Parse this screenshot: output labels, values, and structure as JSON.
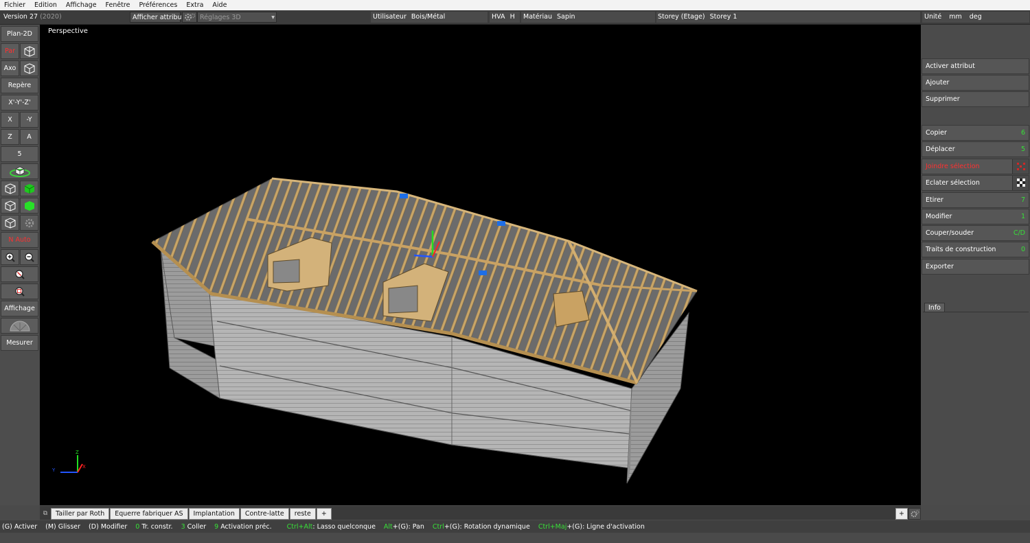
{
  "menu": [
    "Fichier",
    "Edition",
    "Affichage",
    "Fenêtre",
    "Préférences",
    "Extra",
    "Aide"
  ],
  "toolbar": {
    "version": "Version 27",
    "version_year": "(2020)",
    "show_attribute": "Afficher attribut",
    "settings_3d": "Réglages 3D",
    "user_label": "Utilisateur",
    "user_value": "Bois/Métal",
    "hva_label": "HVA",
    "hva_value": "H",
    "material_label": "Matériau",
    "material_value": "Sapin",
    "storey_label": "Storey (Etage)",
    "storey_value": "Storey 1",
    "unit_label": "Unité",
    "unit_length": "mm",
    "unit_angle": "deg"
  },
  "left_buttons": {
    "plan2d": "Plan-2D",
    "par": "Par",
    "axo": "Axo",
    "repere": "Repère",
    "xyz": "X'-Y'-Z'",
    "x": "X",
    "minus_y": "-Y",
    "z": "Z",
    "a": "A",
    "five": "5",
    "auto": "N Auto",
    "affichage": "Affichage",
    "mesurer": "Mesurer"
  },
  "viewport": {
    "label": "Perspective",
    "axis_z": "Z",
    "axis_y": "Y",
    "axis_x": "X"
  },
  "right_panel": {
    "activate_attr": "Activer attribut",
    "add": "Ajouter",
    "delete": "Supprimer",
    "items": [
      {
        "label": "Copier",
        "key": "6"
      },
      {
        "label": "Déplacer",
        "key": "5"
      },
      {
        "label": "Joindre sélection",
        "key": ""
      },
      {
        "label": "Eclater sélection",
        "key": ""
      },
      {
        "label": "Etirer",
        "key": "7"
      },
      {
        "label": "Modifier",
        "key": "1"
      },
      {
        "label": "Couper/souder",
        "key": "C/D"
      },
      {
        "label": "Traits de construction",
        "key": "0"
      },
      {
        "label": "Exporter",
        "key": ""
      }
    ],
    "info_tab": "Info"
  },
  "tabs": [
    "Tailler par Roth",
    "Equerre fabriquer AS",
    "Implantation",
    "Contre-latte",
    "reste",
    "+"
  ],
  "tabs_right": "+",
  "status": [
    {
      "key": "(G)",
      "text": "Activer",
      "key_green": false
    },
    {
      "key": "(M)",
      "text": "Glisser",
      "key_green": false
    },
    {
      "key": "(D)",
      "text": "Modifier",
      "key_green": false
    },
    {
      "key": "0",
      "text": "Tr. constr.",
      "key_green": true
    },
    {
      "key": "3",
      "text": "Coller",
      "key_green": true
    },
    {
      "key": "9",
      "text": "Activation préc.",
      "key_green": true
    },
    {
      "key": "Ctrl+Alt",
      "text": ": Lasso quelconque",
      "key_green": true
    },
    {
      "key": "Alt",
      "text": "+(G): Pan",
      "key_green": true
    },
    {
      "key": "Ctrl",
      "text": "+(G): Rotation dynamique",
      "key_green": true
    },
    {
      "key": "Ctrl+Maj",
      "text": "+(G): Ligne d'activation",
      "key_green": true
    }
  ]
}
